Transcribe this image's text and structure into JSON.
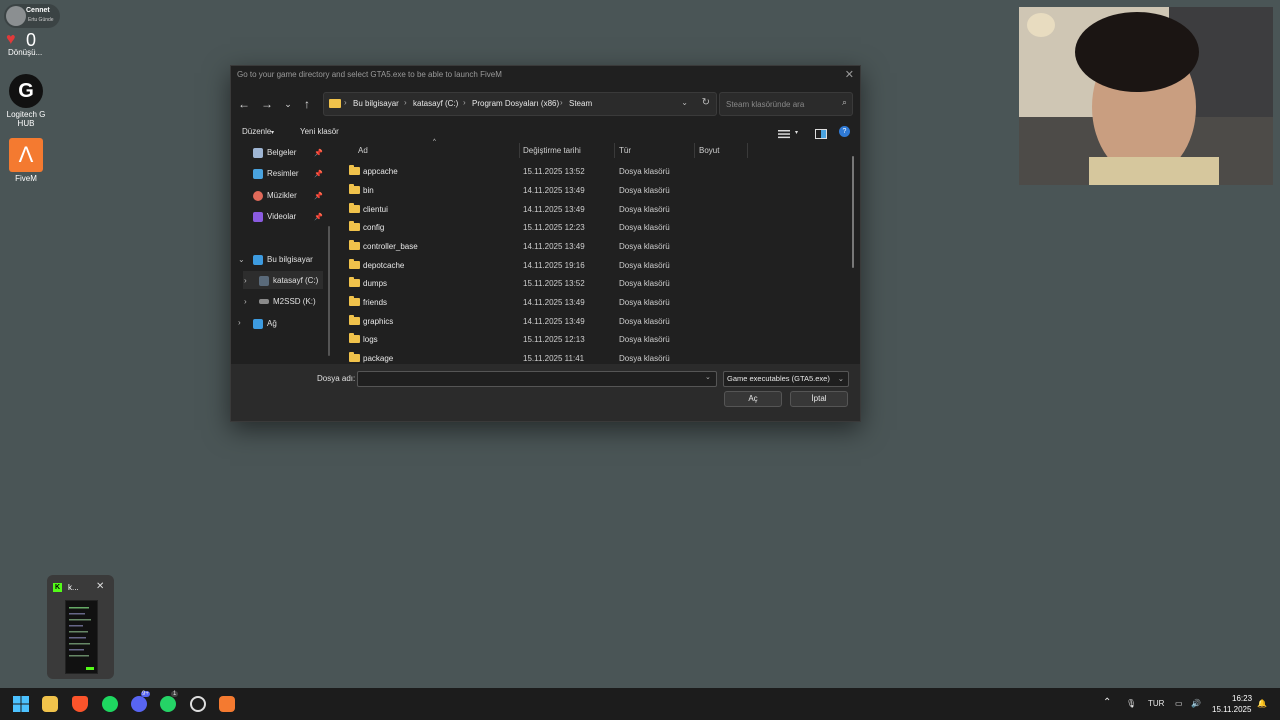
{
  "desktop": {
    "cennet_name": "Cennet",
    "cennet_sub": "Ertu Günde",
    "heart_count": "0",
    "donusu_label": "Dönüşü...",
    "icons": [
      {
        "label": "Logitech G HUB"
      },
      {
        "label": "FiveM"
      }
    ]
  },
  "dialog": {
    "title": "Go to your game directory and select GTA5.exe to be able to launch FiveM",
    "breadcrumbs": [
      "Bu bilgisayar",
      "katasayf (C:)",
      "Program Dosyaları (x86)",
      "Steam"
    ],
    "search_placeholder": "Steam klasöründe ara",
    "toolbar": {
      "organize": "Düzenle",
      "new_folder": "Yeni klasör"
    },
    "nav": {
      "quick": [
        {
          "label": "Belgeler",
          "icon": "documents-icon",
          "color": "#9fb6d4"
        },
        {
          "label": "Resimler",
          "icon": "pictures-icon",
          "color": "#4aa3df"
        },
        {
          "label": "Müzikler",
          "icon": "music-icon",
          "color": "#e06a5a"
        },
        {
          "label": "Videolar",
          "icon": "videos-icon",
          "color": "#8a5be0"
        }
      ],
      "this_pc": "Bu bilgisayar",
      "drive_c": "katasayf (C:)",
      "drive_k": "M2SSD (K:)",
      "network": "Ağ"
    },
    "columns": {
      "name": "Ad",
      "date": "Değiştirme tarihi",
      "type": "Tür",
      "size": "Boyut"
    },
    "files": [
      {
        "name": "appcache",
        "date": "15.11.2025 13:52",
        "type": "Dosya klasörü"
      },
      {
        "name": "bin",
        "date": "14.11.2025 13:49",
        "type": "Dosya klasörü"
      },
      {
        "name": "clientui",
        "date": "14.11.2025 13:49",
        "type": "Dosya klasörü"
      },
      {
        "name": "config",
        "date": "15.11.2025 12:23",
        "type": "Dosya klasörü"
      },
      {
        "name": "controller_base",
        "date": "14.11.2025 13:49",
        "type": "Dosya klasörü"
      },
      {
        "name": "depotcache",
        "date": "14.11.2025 19:16",
        "type": "Dosya klasörü"
      },
      {
        "name": "dumps",
        "date": "15.11.2025 13:52",
        "type": "Dosya klasörü"
      },
      {
        "name": "friends",
        "date": "14.11.2025 13:49",
        "type": "Dosya klasörü"
      },
      {
        "name": "graphics",
        "date": "14.11.2025 13:49",
        "type": "Dosya klasörü"
      },
      {
        "name": "logs",
        "date": "15.11.2025 12:13",
        "type": "Dosya klasörü"
      },
      {
        "name": "package",
        "date": "15.11.2025 11:41",
        "type": "Dosya klasörü"
      }
    ],
    "filename_label": "Dosya adı:",
    "filename_value": "",
    "filter": "Game executables (GTA5.exe)",
    "open": "Aç",
    "cancel": "İptal"
  },
  "preview": {
    "title": "k..."
  },
  "taskbar": {
    "lang": "TUR",
    "time": "16:23",
    "date": "15.11.2025",
    "discord_badge": "9+",
    "whatsapp_badge": "1"
  }
}
